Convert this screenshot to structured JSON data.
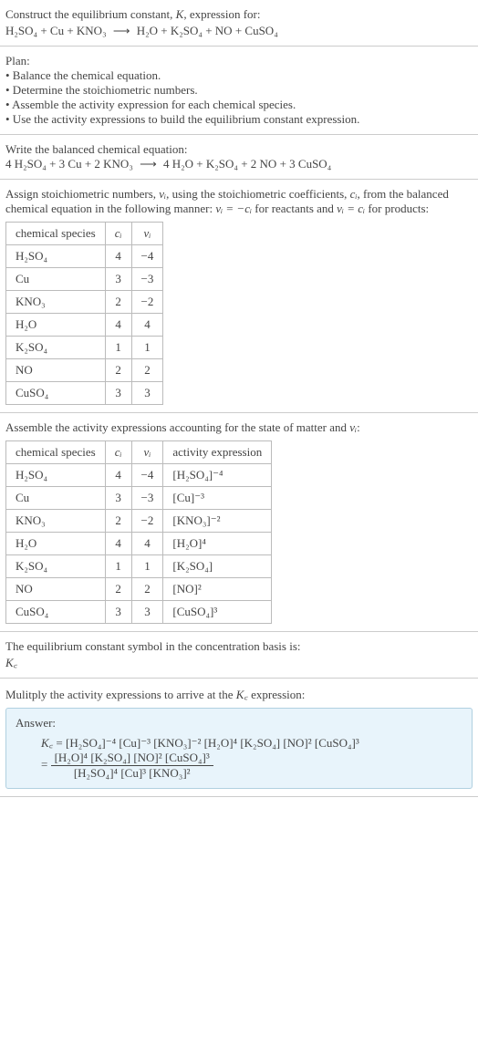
{
  "s1": {
    "line1_a": "Construct the equilibrium constant, ",
    "line1_k": "K",
    "line1_b": ", expression for:",
    "eq_lhs": "H₂SO₄ + Cu + KNO₃",
    "arrow": "⟶",
    "eq_rhs": "H₂O + K₂SO₄ + NO + CuSO₄"
  },
  "s2": {
    "heading": "Plan:",
    "b1": "• Balance the chemical equation.",
    "b2": "• Determine the stoichiometric numbers.",
    "b3": "• Assemble the activity expression for each chemical species.",
    "b4": "• Use the activity expressions to build the equilibrium constant expression."
  },
  "s3": {
    "heading": "Write the balanced chemical equation:",
    "eq_lhs": "4 H₂SO₄ + 3 Cu + 2 KNO₃",
    "arrow": "⟶",
    "eq_rhs": "4 H₂O + K₂SO₄ + 2 NO + 3 CuSO₄"
  },
  "s4": {
    "l1a": "Assign stoichiometric numbers, ",
    "vi": "νᵢ",
    "l1b": ", using the stoichiometric coefficients, ",
    "ci": "cᵢ",
    "l1c": ", from the balanced chemical equation in the following manner: ",
    "rel1": "νᵢ = −cᵢ",
    "l1d": " for reactants and ",
    "rel2": "νᵢ = cᵢ",
    "l1e": " for products:",
    "h1": "chemical species",
    "h2": "cᵢ",
    "h3": "νᵢ",
    "r1c1": "H₂SO₄",
    "r1c2": "4",
    "r1c3": "−4",
    "r2c1": "Cu",
    "r2c2": "3",
    "r2c3": "−3",
    "r3c1": "KNO₃",
    "r3c2": "2",
    "r3c3": "−2",
    "r4c1": "H₂O",
    "r4c2": "4",
    "r4c3": "4",
    "r5c1": "K₂SO₄",
    "r5c2": "1",
    "r5c3": "1",
    "r6c1": "NO",
    "r6c2": "2",
    "r6c3": "2",
    "r7c1": "CuSO₄",
    "r7c2": "3",
    "r7c3": "3"
  },
  "s5": {
    "heading_a": "Assemble the activity expressions accounting for the state of matter and ",
    "vi": "νᵢ",
    "heading_b": ":",
    "h1": "chemical species",
    "h2": "cᵢ",
    "h3": "νᵢ",
    "h4": "activity expression",
    "r1c1": "H₂SO₄",
    "r1c2": "4",
    "r1c3": "−4",
    "r1c4": "[H₂SO₄]⁻⁴",
    "r2c1": "Cu",
    "r2c2": "3",
    "r2c3": "−3",
    "r2c4": "[Cu]⁻³",
    "r3c1": "KNO₃",
    "r3c2": "2",
    "r3c3": "−2",
    "r3c4": "[KNO₃]⁻²",
    "r4c1": "H₂O",
    "r4c2": "4",
    "r4c3": "4",
    "r4c4": "[H₂O]⁴",
    "r5c1": "K₂SO₄",
    "r5c2": "1",
    "r5c3": "1",
    "r5c4": "[K₂SO₄]",
    "r6c1": "NO",
    "r6c2": "2",
    "r6c3": "2",
    "r6c4": "[NO]²",
    "r7c1": "CuSO₄",
    "r7c2": "3",
    "r7c3": "3",
    "r7c4": "[CuSO₄]³"
  },
  "s6": {
    "line": "The equilibrium constant symbol in the concentration basis is:",
    "kc": "K꜀"
  },
  "s7": {
    "line_a": "Mulitply the activity expressions to arrive at the ",
    "kc": "K꜀",
    "line_b": " expression:"
  },
  "ans": {
    "label": "Answer:",
    "kc": "K꜀",
    "eq": " = ",
    "line1": "[H₂SO₄]⁻⁴ [Cu]⁻³ [KNO₃]⁻² [H₂O]⁴ [K₂SO₄] [NO]² [CuSO₄]³",
    "eq2": "= ",
    "num": "[H₂O]⁴ [K₂SO₄] [NO]² [CuSO₄]³",
    "den": "[H₂SO₄]⁴ [Cu]³ [KNO₃]²"
  }
}
